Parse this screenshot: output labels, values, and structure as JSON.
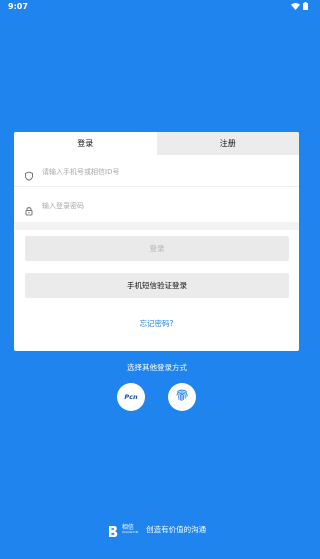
{
  "status_bar": {
    "time": "9:07"
  },
  "tabs": {
    "login": "登录",
    "register": "注册"
  },
  "fields": {
    "phone_placeholder": "请输入手机号或相信ID号",
    "password_placeholder": "输入登录密码"
  },
  "buttons": {
    "login": "登录",
    "sms_login": "手机短信验证登录",
    "forgot_password": "忘记密码?"
  },
  "other_login": {
    "title": "选择其他登录方式",
    "pcn_label": "Pcn"
  },
  "footer": {
    "logo_cn": "相信",
    "logo_en": "XIANGXIN",
    "slogan": "创造有价值的沟通"
  },
  "colors": {
    "background": "#1f84ee",
    "card": "#ffffff",
    "accent": "#1f84ee"
  },
  "icons": [
    "wifi-icon",
    "battery-icon",
    "phone-shield-icon",
    "lock-icon",
    "fingerprint-icon",
    "logo-b-icon"
  ]
}
